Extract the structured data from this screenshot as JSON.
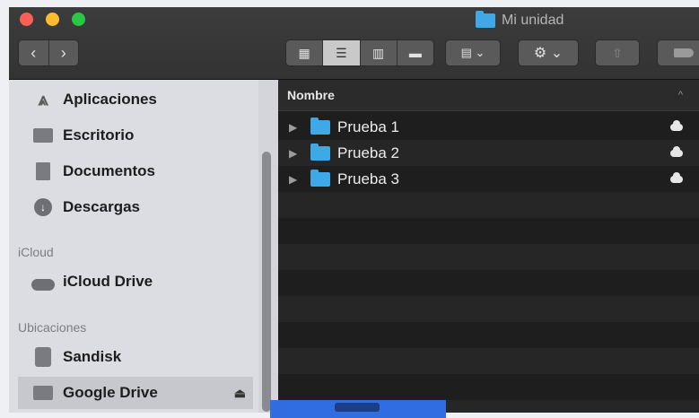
{
  "window": {
    "title": "Mi unidad"
  },
  "toolbar": {
    "back_icon": "chevron-left-icon",
    "forward_icon": "chevron-right-icon",
    "view_modes": [
      "icons",
      "list",
      "columns",
      "gallery"
    ],
    "active_view": "list"
  },
  "sidebar": {
    "items_top": [
      {
        "label": "Aplicaciones",
        "icon": "applications-icon"
      },
      {
        "label": "Escritorio",
        "icon": "desktop-icon"
      },
      {
        "label": "Documentos",
        "icon": "documents-icon"
      },
      {
        "label": "Descargas",
        "icon": "downloads-icon"
      }
    ],
    "section_icloud": "iCloud",
    "icloud_items": [
      {
        "label": "iCloud Drive",
        "icon": "cloud-icon"
      }
    ],
    "section_locations": "Ubicaciones",
    "locations": [
      {
        "label": "Sandisk",
        "icon": "disk-icon"
      },
      {
        "label": "Google Drive",
        "icon": "drive-icon",
        "selected": true,
        "eject_icon": "eject-icon"
      }
    ]
  },
  "list": {
    "column_name": "Nombre",
    "rows": [
      {
        "name": "Prueba 1"
      },
      {
        "name": "Prueba 2"
      },
      {
        "name": "Prueba 3"
      }
    ]
  },
  "colors": {
    "folder": "#3fa9e7",
    "selected_sidebar": "#c7c8ce",
    "accent_blue": "#2f6de1"
  }
}
